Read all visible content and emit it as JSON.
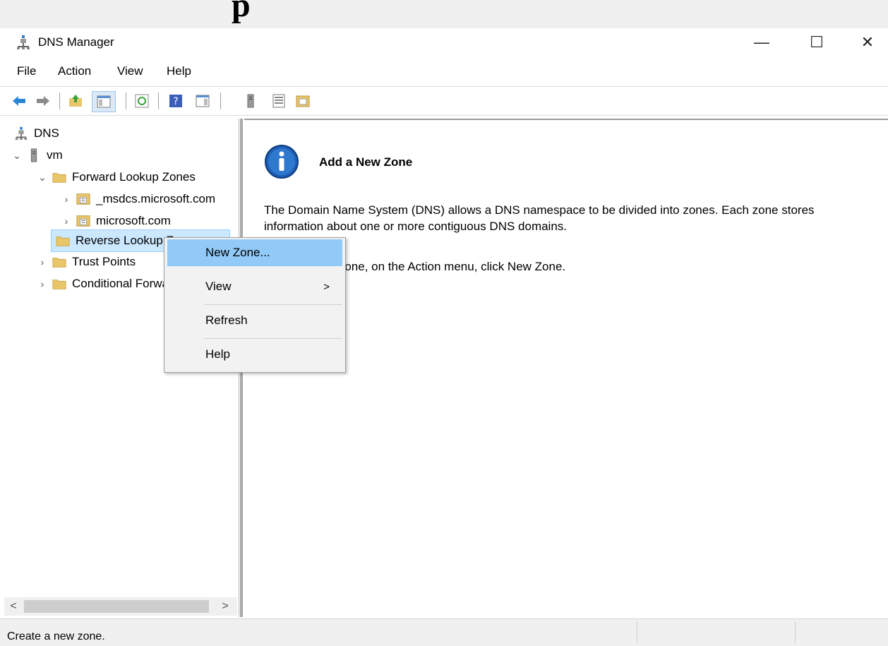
{
  "top_fragment": "p",
  "window": {
    "title": "DNS Manager",
    "controls": {
      "minimize": "—",
      "maximize": "☐",
      "close": "✕"
    }
  },
  "menu": {
    "items": [
      {
        "label": "File"
      },
      {
        "label": "Action"
      },
      {
        "label": "View"
      },
      {
        "label": "Help"
      }
    ]
  },
  "tree": {
    "root": "DNS",
    "server": "vm",
    "forward_lookup_zones": "Forward Lookup Zones",
    "zone_msdcs": "_msdcs.microsoft.com",
    "zone_microsoft": "microsoft.com",
    "reverse_lookup_zones": "Reverse Lookup Zones",
    "trust_points": "Trust Points",
    "conditional_forwarders": "Conditional Forwarders"
  },
  "scroll": {
    "left_arrow": "<",
    "right_arrow": ">"
  },
  "content": {
    "title": "Add a New Zone",
    "body": "The Domain Name System (DNS) allows a DNS namespace to be divided into zones. Each zone stores information about one or more contiguous DNS domains.",
    "action": "To add a new zone, on the Action menu, click New Zone."
  },
  "context_menu": {
    "items": [
      {
        "label": "New Zone..."
      },
      {
        "label": "View",
        "arrow": ">"
      },
      {
        "label": "Refresh"
      },
      {
        "label": "Help"
      }
    ]
  },
  "status": {
    "text": "Create a new zone."
  },
  "colors": {
    "selection": "#cce8ff",
    "menu_highlight": "#91c9f7",
    "folder": "#e9c66a",
    "info_blue": "#1f5fb4"
  }
}
